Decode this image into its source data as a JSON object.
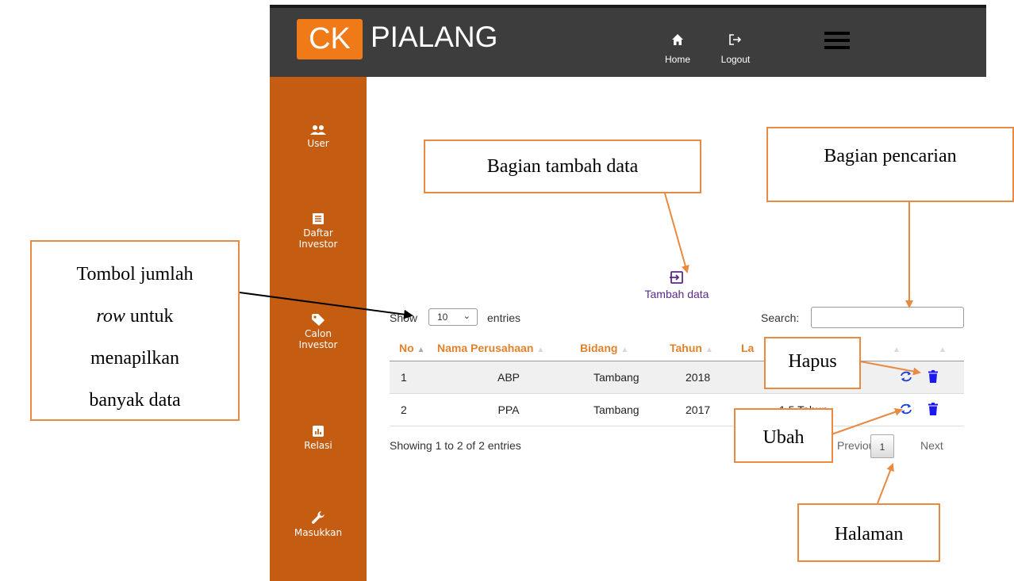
{
  "app": {
    "brand_badge": "CK",
    "brand_name": "PIALANG"
  },
  "nav": {
    "home": "Home",
    "logout": "Logout"
  },
  "sidebar": {
    "items": [
      {
        "label": "User",
        "icon": "users-icon"
      },
      {
        "label": "Daftar Investor",
        "icon": "list-icon"
      },
      {
        "label": "Calon Investor",
        "icon": "tag-icon"
      },
      {
        "label": "Relasi",
        "icon": "chart-icon"
      },
      {
        "label": "Masukkan",
        "icon": "wrench-icon"
      }
    ]
  },
  "toolbar": {
    "add_label": "Tambah data",
    "show_label": "Show",
    "entries_value": "10",
    "entries_label": "entries",
    "search_label": "Search:"
  },
  "table": {
    "columns": [
      "No",
      "Nama Perusahaan",
      "Bidang",
      "Tahun",
      "La",
      "",
      ""
    ],
    "rows": [
      {
        "no": "1",
        "nama": "ABP",
        "bidang": "Tambang",
        "tahun": "2018",
        "lama": ""
      },
      {
        "no": "2",
        "nama": "PPA",
        "bidang": "Tambang",
        "tahun": "2017",
        "lama": "1,5 Tahun"
      }
    ]
  },
  "footer": {
    "showing": "Showing 1 to 2 of 2 entries",
    "previous": "Previous",
    "page": "1",
    "next": "Next"
  },
  "annotations": {
    "tambah": "Bagian tambah data",
    "pencarian": "Bagian pencarian",
    "tombol_line1": "Tombol jumlah",
    "tombol_row": "row",
    "tombol_untuk": " untuk",
    "tombol_line3": "menapilkan",
    "tombol_line4": "banyak data",
    "hapus": "Hapus",
    "ubah": "Ubah",
    "halaman": "Halaman"
  },
  "colors": {
    "sidebar": "#c45c11",
    "topbar": "#3d3d3d",
    "brand": "#f07a18",
    "header_text": "#e0822c",
    "callout_border": "#e88a42",
    "delete_icon": "#1a1aee",
    "refresh_icon": "#1a3ad8"
  }
}
